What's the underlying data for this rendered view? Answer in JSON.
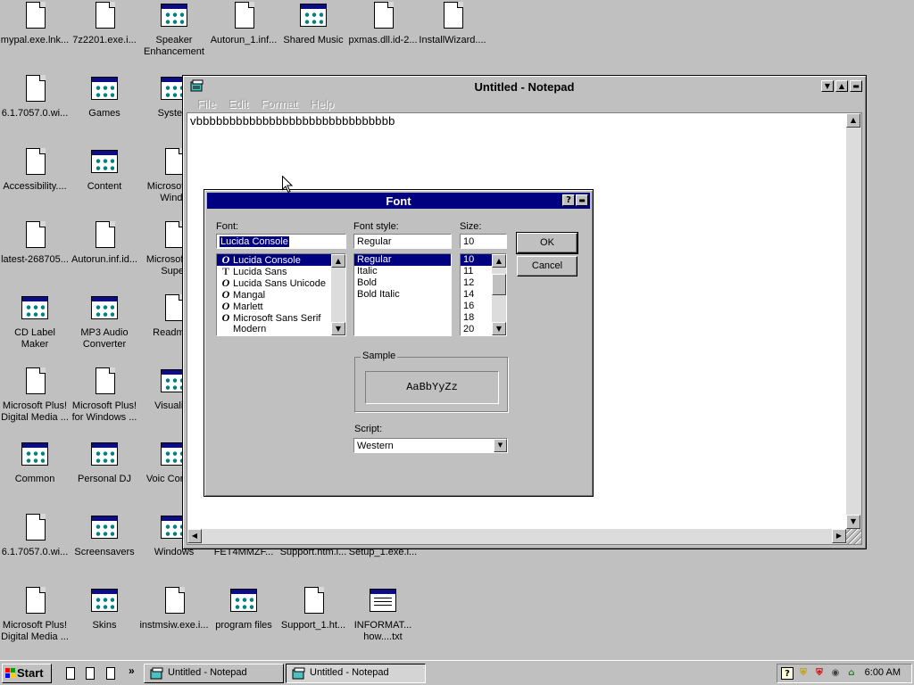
{
  "desktop": {
    "icons": [
      {
        "id": "mypal",
        "label": "mypal.exe.lnk...",
        "kind": "file"
      },
      {
        "id": "7z2201",
        "label": "7z2201.exe.i...",
        "kind": "file"
      },
      {
        "id": "speaker",
        "label": "Speaker Enhancement",
        "kind": "group"
      },
      {
        "id": "autorun1",
        "label": "Autorun_1.inf...",
        "kind": "file"
      },
      {
        "id": "sharedmusic",
        "label": "Shared Music",
        "kind": "group"
      },
      {
        "id": "pxmas",
        "label": "pxmas.dll.id-2...",
        "kind": "file"
      },
      {
        "id": "installwizard",
        "label": "InstallWizard....",
        "kind": "file"
      },
      {
        "id": "wi1",
        "label": "6.1.7057.0.wi...",
        "kind": "file"
      },
      {
        "id": "games",
        "label": "Games",
        "kind": "group"
      },
      {
        "id": "system",
        "label": "System",
        "kind": "group"
      },
      {
        "id": "accessibility",
        "label": "Accessibility....",
        "kind": "file"
      },
      {
        "id": "content",
        "label": "Content",
        "kind": "group"
      },
      {
        "id": "microsoftwin",
        "label": "Microsoft for Windo",
        "kind": "file"
      },
      {
        "id": "latest",
        "label": "latest-268705...",
        "kind": "file"
      },
      {
        "id": "autoruninf",
        "label": "Autorun.inf.id...",
        "kind": "file"
      },
      {
        "id": "xpsuper",
        "label": "Microsoft XP Super",
        "kind": "file"
      },
      {
        "id": "cdlabel",
        "label": "CD Label Maker",
        "kind": "group"
      },
      {
        "id": "mp3",
        "label": "MP3 Audio Converter",
        "kind": "group"
      },
      {
        "id": "readme",
        "label": "Readme.I",
        "kind": "file"
      },
      {
        "id": "plusdigital1",
        "label": "Microsoft Plus! Digital Media ...",
        "kind": "file"
      },
      {
        "id": "pluswin",
        "label": "Microsoft Plus! for Windows ...",
        "kind": "file"
      },
      {
        "id": "visualiza",
        "label": "Visualiza",
        "kind": "group"
      },
      {
        "id": "common",
        "label": "Common",
        "kind": "group"
      },
      {
        "id": "personaldj",
        "label": "Personal DJ",
        "kind": "group"
      },
      {
        "id": "voice",
        "label": "Voic Comma",
        "kind": "group"
      },
      {
        "id": "wi2",
        "label": "6.1.7057.0.wi...",
        "kind": "file"
      },
      {
        "id": "screensavers",
        "label": "Screensavers",
        "kind": "group"
      },
      {
        "id": "windows",
        "label": "Windows",
        "kind": "group"
      },
      {
        "id": "fet4",
        "label": "FET4MMZF...",
        "kind": "hidden"
      },
      {
        "id": "supporthtm",
        "label": "Support.htm.i...",
        "kind": "hidden"
      },
      {
        "id": "setup1",
        "label": "Setup_1.exe.i...",
        "kind": "hidden"
      },
      {
        "id": "plusdigital2",
        "label": "Microsoft Plus! Digital Media ...",
        "kind": "file"
      },
      {
        "id": "skins",
        "label": "Skins",
        "kind": "group"
      },
      {
        "id": "instmsiw",
        "label": "instmsiw.exe.i...",
        "kind": "file"
      },
      {
        "id": "programfiles",
        "label": "program files",
        "kind": "group"
      },
      {
        "id": "support1",
        "label": "Support_1.ht...",
        "kind": "file"
      },
      {
        "id": "information",
        "label": "INFORMAT... how....txt",
        "kind": "text"
      }
    ]
  },
  "notepad": {
    "title": "Untitled - Notepad",
    "menu": [
      "File",
      "Edit",
      "Format",
      "Help"
    ],
    "content": "vbbbbbbbbbbbbbbbbbbbbbbbbbbbbbb"
  },
  "font_dialog": {
    "title": "Font",
    "font_label": "Font:",
    "font_value": "Lucida Console",
    "fonts": [
      {
        "name": "Lucida Console",
        "icon": "O",
        "selected": true
      },
      {
        "name": "Lucida Sans",
        "icon": "T",
        "selected": false
      },
      {
        "name": "Lucida Sans Unicode",
        "icon": "O",
        "selected": false
      },
      {
        "name": "Mangal",
        "icon": "O",
        "selected": false
      },
      {
        "name": "Marlett",
        "icon": "O",
        "selected": false
      },
      {
        "name": "Microsoft Sans Serif",
        "icon": "O",
        "selected": false
      },
      {
        "name": "Modern",
        "icon": "",
        "selected": false
      }
    ],
    "style_label": "Font style:",
    "style_value": "Regular",
    "styles": [
      "Regular",
      "Italic",
      "Bold",
      "Bold Italic"
    ],
    "size_label": "Size:",
    "size_value": "10",
    "sizes": [
      "10",
      "11",
      "12",
      "14",
      "16",
      "18",
      "20"
    ],
    "ok_label": "OK",
    "cancel_label": "Cancel",
    "sample_label": "Sample",
    "sample_text": "AaBbYyZz",
    "script_label": "Script:",
    "script_value": "Western"
  },
  "taskbar": {
    "start_label": "Start",
    "tasks": [
      {
        "label": "Untitled - Notepad",
        "active": false
      },
      {
        "label": "Untitled - Notepad",
        "active": true
      }
    ],
    "clock": "6:00 AM",
    "tray_icons": [
      "help-icon",
      "shield-icon",
      "security-alert-icon",
      "volume-icon",
      "network-icon"
    ]
  }
}
